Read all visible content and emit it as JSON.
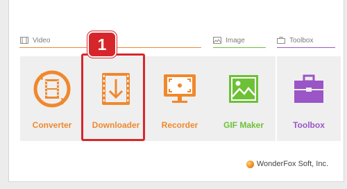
{
  "sections": {
    "video": {
      "label": "Video",
      "color": "#f0882d"
    },
    "image": {
      "label": "Image",
      "color": "#6cc136"
    },
    "toolbox": {
      "label": "Toolbox",
      "color": "#9a55c6"
    }
  },
  "tiles": [
    {
      "label": "Converter",
      "icon": "converter-film-icon",
      "color": "#f0882d"
    },
    {
      "label": "Downloader",
      "icon": "download-arrow-icon",
      "color": "#f0882d"
    },
    {
      "label": "Recorder",
      "icon": "screen-recorder-icon",
      "color": "#f0882d"
    },
    {
      "label": "GIF Maker",
      "icon": "landscape-image-icon",
      "color": "#6cc136"
    },
    {
      "label": "Toolbox",
      "icon": "toolbox-icon",
      "color": "#9a55c6"
    }
  ],
  "annotation": {
    "badge": "1",
    "color": "#d7262b"
  },
  "footer": {
    "company": "WonderFox Soft, Inc."
  }
}
